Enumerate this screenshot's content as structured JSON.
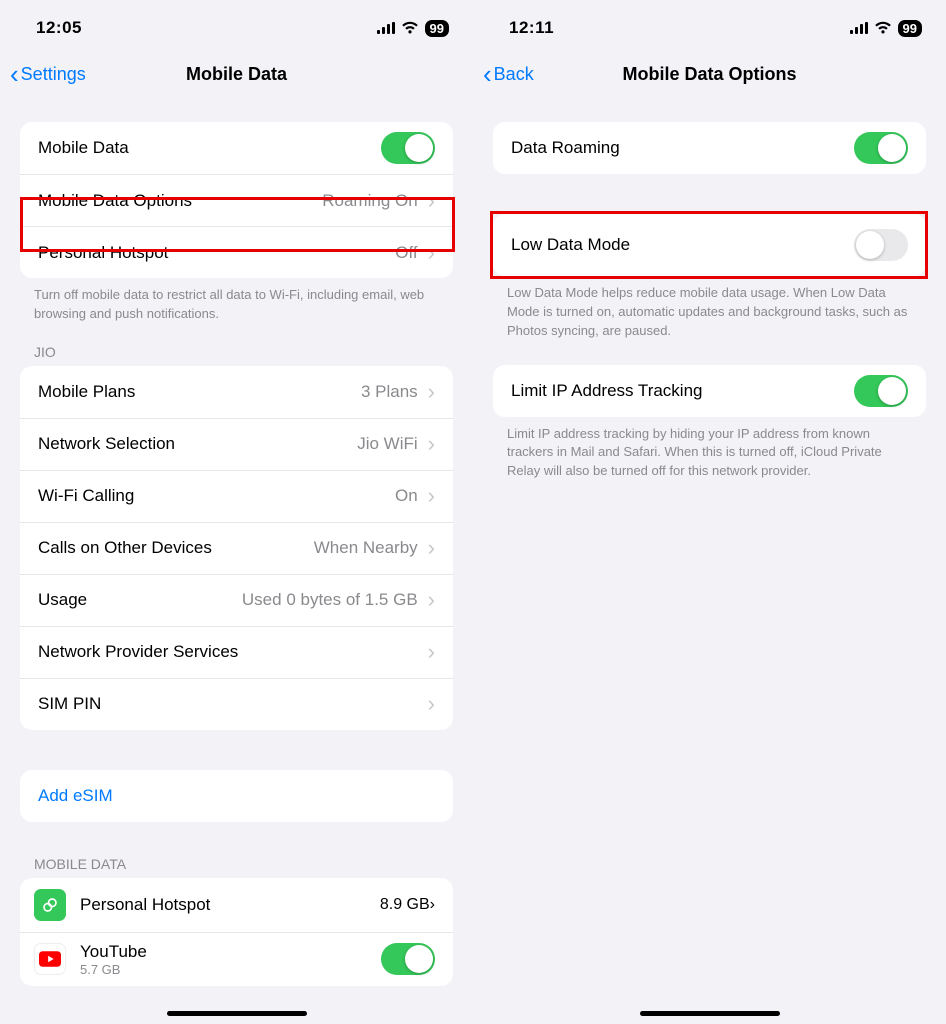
{
  "left": {
    "status": {
      "time": "12:05",
      "battery": "99"
    },
    "nav": {
      "back": "Settings",
      "title": "Mobile Data"
    },
    "group1": {
      "mobile_data": "Mobile Data",
      "options": {
        "label": "Mobile Data Options",
        "value": "Roaming On"
      },
      "hotspot": {
        "label": "Personal Hotspot",
        "value": "Off"
      }
    },
    "footer1": "Turn off mobile data to restrict all data to Wi-Fi, including email, web browsing and push notifications.",
    "jio_header": "JIO",
    "jio": {
      "plans": {
        "label": "Mobile Plans",
        "value": "3 Plans"
      },
      "network": {
        "label": "Network Selection",
        "value": "Jio WiFi"
      },
      "wificall": {
        "label": "Wi-Fi Calling",
        "value": "On"
      },
      "other": {
        "label": "Calls on Other Devices",
        "value": "When Nearby"
      },
      "usage": {
        "label": "Usage",
        "value": "Used 0 bytes of 1.5 GB"
      },
      "provider": "Network Provider Services",
      "sim": "SIM PIN"
    },
    "add_esim": "Add eSIM",
    "apps_header": "MOBILE DATA",
    "apps": {
      "hotspot": {
        "title": "Personal Hotspot",
        "value": "8.9 GB"
      },
      "youtube": {
        "title": "YouTube",
        "sub": "5.7 GB"
      }
    }
  },
  "right": {
    "status": {
      "time": "12:11",
      "battery": "99"
    },
    "nav": {
      "back": "Back",
      "title": "Mobile Data Options"
    },
    "roaming": "Data Roaming",
    "lowdata": "Low Data Mode",
    "lowdata_footer": "Low Data Mode helps reduce mobile data usage. When Low Data Mode is turned on, automatic updates and background tasks, such as Photos syncing, are paused.",
    "limitip": "Limit IP Address Tracking",
    "limitip_footer": "Limit IP address tracking by hiding your IP address from known trackers in Mail and Safari. When this is turned off, iCloud Private Relay will also be turned off for this network provider."
  }
}
